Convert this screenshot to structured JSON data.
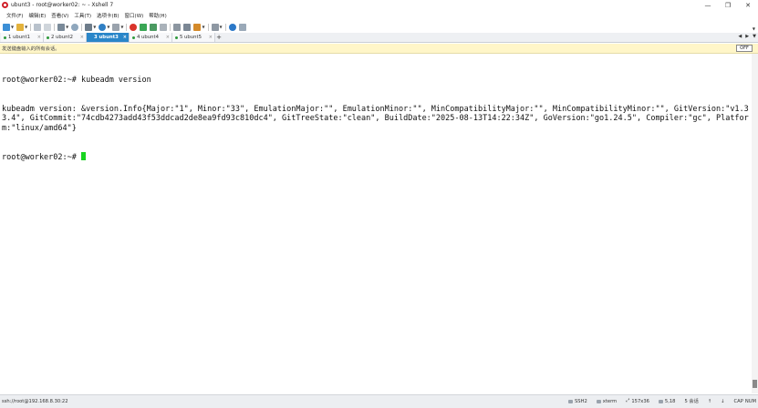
{
  "window": {
    "title": "ubunt3 - root@worker02: ~ - Xshell 7",
    "controls": {
      "minimize": "—",
      "restore": "❐",
      "close": "✕"
    },
    "accent": "#2a86c9"
  },
  "menu": [
    "文件(F)",
    "编辑(E)",
    "查看(V)",
    "工具(T)",
    "选项卡(B)",
    "窗口(W)",
    "帮助(H)"
  ],
  "tabs": [
    {
      "label": "1 ubunt1",
      "active": false
    },
    {
      "label": "2 ubunt2",
      "active": false
    },
    {
      "label": "3 ubunt3",
      "active": true
    },
    {
      "label": "4 ubunt4",
      "active": false
    },
    {
      "label": "5 ubunt5",
      "active": false
    }
  ],
  "tab_add": "+",
  "compose": {
    "hint": "发送键盘输入的所有会话。",
    "toggle": "OFF"
  },
  "terminal": {
    "lines": [
      "root@worker02:~# kubeadm version",
      "kubeadm version: &version.Info{Major:\"1\", Minor:\"33\", EmulationMajor:\"\", EmulationMinor:\"\", MinCompatibilityMajor:\"\", MinCompatibilityMinor:\"\", GitVersion:\"v1.33.4\", GitCommit:\"74cdb4273add43f53ddcad2de8ea9fd93c810dc4\", GitTreeState:\"clean\", BuildDate:\"2025-08-13T14:22:34Z\", GoVersion:\"go1.24.5\", Compiler:\"gc\", Platform:\"linux/amd64\"}"
    ],
    "prompt": "root@worker02:~# ",
    "cursor_color": "#18d420"
  },
  "status": {
    "connection": "ssh://root@192.168.8.30:22",
    "protocol": "SSH2",
    "term": "xterm",
    "size": "157x36",
    "position": "5,18",
    "sessions": "5 会话",
    "caps": "CAP",
    "num": "NUM"
  }
}
